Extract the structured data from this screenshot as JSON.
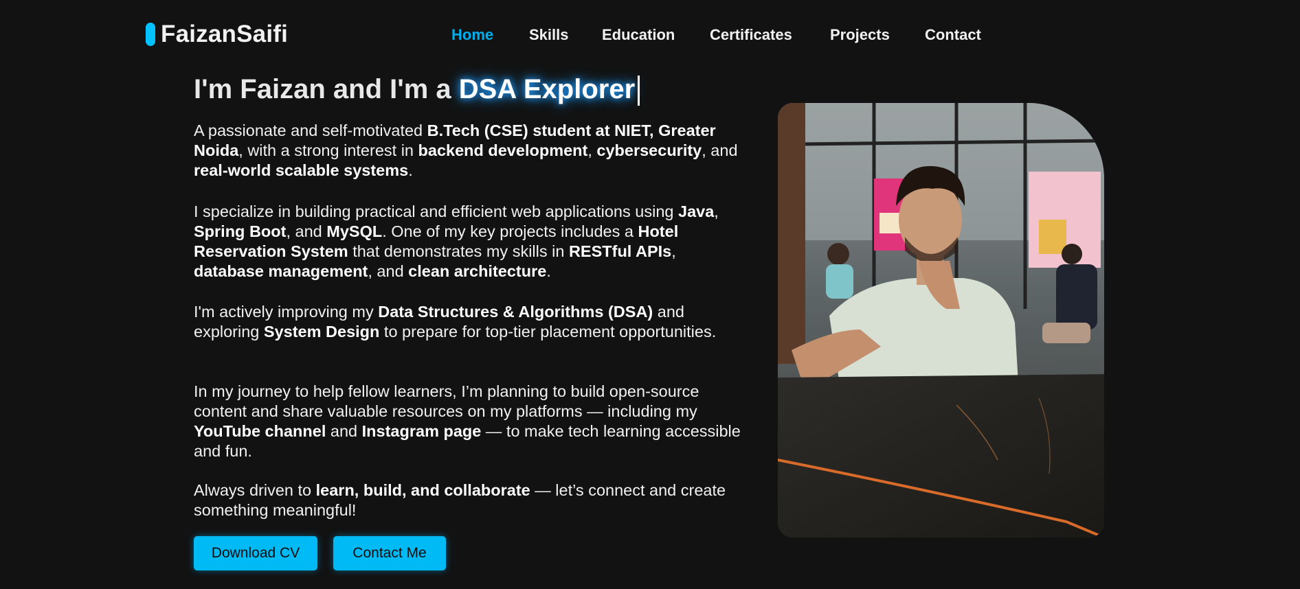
{
  "logo": {
    "name": "FaizanSaifi"
  },
  "nav": [
    {
      "label": "Home",
      "active": true
    },
    {
      "label": "Skills",
      "active": false
    },
    {
      "label": "Education",
      "active": false
    },
    {
      "label": "Certificates",
      "active": false
    },
    {
      "label": "Projects",
      "active": false
    },
    {
      "label": "Contact",
      "active": false
    }
  ],
  "hero": {
    "title_prefix": "I'm Faizan and I'm a ",
    "title_role": "DSA Explorer",
    "p1": {
      "t1": "A passionate and self-motivated ",
      "b1": "B.Tech (CSE) student at NIET, Greater Noida",
      "t2": ", with a strong interest in ",
      "b2": "backend development",
      "t3": ", ",
      "b3": "cybersecurity",
      "t4": ", and ",
      "b4": "real-world scalable systems",
      "t5": "."
    },
    "p2": {
      "t1": "I specialize in building practical and efficient web applications using ",
      "b1": "Java",
      "t2": ", ",
      "b2": "Spring Boot",
      "t3": ", and ",
      "b3": "MySQL",
      "t4": ". One of my key projects includes a ",
      "b4": "Hotel Reservation System",
      "t5": " that demonstrates my skills in ",
      "b5": "RESTful APIs",
      "t6": ", ",
      "b6": "database management",
      "t7": ", and ",
      "b7": "clean architecture",
      "t8": "."
    },
    "p3": {
      "t1": "I'm actively improving my ",
      "b1": "Data Structures & Algorithms (DSA)",
      "t2": " and exploring ",
      "b2": "System Design",
      "t3": " to prepare for top-tier placement opportunities."
    },
    "p4": {
      "t1": "In my journey to help fellow learners, I’m planning to build open-source content and share valuable resources on my platforms — including my ",
      "b1": "YouTube channel",
      "t2": " and ",
      "b2": "Instagram page",
      "t3": " — to make tech learning accessible and fun."
    },
    "p5": {
      "t1": "Always driven to ",
      "b1": "learn, build, and collaborate",
      "t2": " — let’s connect and create something meaningful!"
    },
    "buttons": {
      "download_cv": "Download CV",
      "contact_me": "Contact Me"
    }
  },
  "colors": {
    "background": "#121212",
    "accent": "#00baf5",
    "nav_active": "#00aef0",
    "text": "#ffffff"
  },
  "photo": {
    "alt": "Faizan sitting at a cafe table"
  }
}
